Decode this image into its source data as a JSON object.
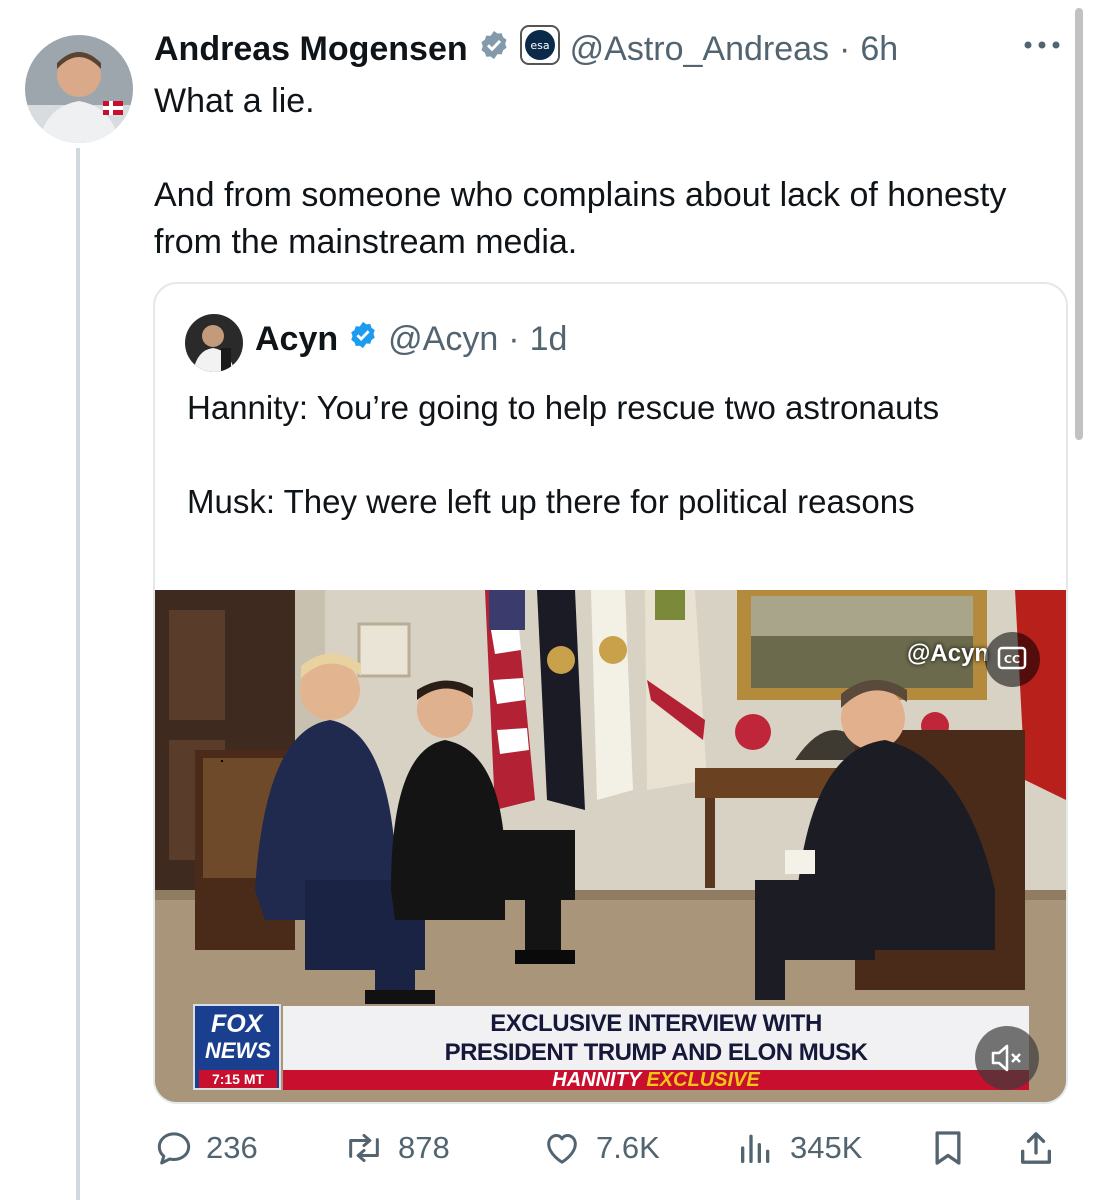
{
  "tweet": {
    "author": {
      "display_name": "Andreas Mogensen",
      "handle": "@Astro_Andreas",
      "affiliation_badge": "esa"
    },
    "separator": "·",
    "time": "6h",
    "text_paragraphs": [
      "What a lie.",
      "And from someone who complains about lack of honesty from the mainstream media."
    ]
  },
  "quoted_tweet": {
    "author": {
      "display_name": "Acyn",
      "handle": "@Acyn"
    },
    "separator": "·",
    "time": "1d",
    "text_paragraphs": [
      "Hannity: You’re going to help rescue two astronauts",
      "Musk: They were left up there for political reasons"
    ],
    "video": {
      "watermark": "@Acyn",
      "cc_label": "CC",
      "chyron_line1": "EXCLUSIVE INTERVIEW WITH",
      "chyron_line2": "PRESIDENT TRUMP AND ELON MUSK",
      "sub_banner_show": "HANNITY",
      "sub_banner_tag": "EXCLUSIVE",
      "network_line1": "FOX",
      "network_line2": "NEWS",
      "clock": "7:15 MT"
    }
  },
  "actions": {
    "replies": "236",
    "reposts": "878",
    "likes": "7.6K",
    "views": "345K"
  },
  "colors": {
    "text": "#0f1419",
    "secondary": "#536471",
    "verified": "#1d9bf0",
    "border": "#e3e8eb",
    "fox_red": "#c8102e",
    "fox_blue": "#1b3f8f"
  },
  "icons": [
    "verified-badge-icon",
    "esa-badge-icon",
    "more-icon",
    "reply-icon",
    "repost-icon",
    "like-icon",
    "views-icon",
    "bookmark-icon",
    "share-icon",
    "mute-icon",
    "closed-captions-icon"
  ]
}
